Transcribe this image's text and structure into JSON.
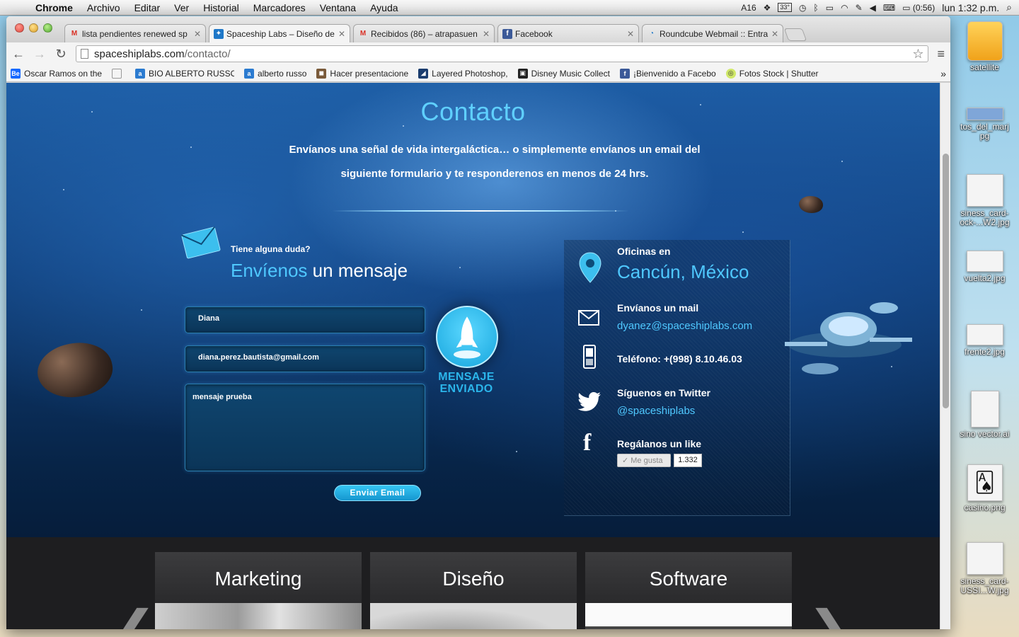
{
  "menubar": {
    "app": "Chrome",
    "items": [
      "Archivo",
      "Editar",
      "Ver",
      "Historial",
      "Marcadores",
      "Ventana",
      "Ayuda"
    ],
    "tray": {
      "adobe_count": "16",
      "temp": "33°",
      "battery": "(0:56)",
      "clock": "lun 1:32 p.m."
    }
  },
  "browser": {
    "tabs": [
      {
        "title": "lista pendientes renewed sp",
        "icon": "gmail-icon"
      },
      {
        "title": "Spaceship Labs – Diseño de",
        "icon": "spaceship-icon"
      },
      {
        "title": "Recibidos (86) – atrapasuen",
        "icon": "gmail-icon"
      },
      {
        "title": "Facebook",
        "icon": "facebook-icon"
      },
      {
        "title": "Roundcube Webmail :: Entra",
        "icon": "roundcube-icon"
      }
    ],
    "url_host": "spaceshiplabs.com",
    "url_path": "/contacto/",
    "bookmarks": [
      "Oscar Ramos on the",
      "",
      "BIO ALBERTO RUSSO",
      "alberto russo",
      "Hacer presentacione",
      "Layered Photoshop,",
      "Disney Music Collect",
      "¡Bienvenido a Facebo",
      "Fotos Stock | Shutter"
    ]
  },
  "page": {
    "title": "Contacto",
    "intro": "Envíanos una señal de vida intergaláctica… o simplemente envíanos un email del siguiente formulario y te responderenos en menos de 24 hrs.",
    "form": {
      "question": "Tiene alguna duda?",
      "heading_highlight": "Envíenos",
      "heading_rest": " un mensaje",
      "name_value": "Diana",
      "email_value": "diana.perez.bautista@gmail.com",
      "message_value": "mensaje prueba",
      "submit_label": "Enviar Email",
      "sent_line1": "MENSAJE",
      "sent_line2": "ENVIADO"
    },
    "info": {
      "office_label": "Oficinas en",
      "office_city": "Cancún, México",
      "mail_label": "Envíanos un mail",
      "mail_value": "dyanez@spaceshiplabs.com",
      "phone": "Teléfono: +(998) 8.10.46.03",
      "twitter_label": "Síguenos en Twitter",
      "twitter_handle": "@spaceshiplabs",
      "like_label": "Regálanos un like",
      "like_button": "✓ Me gusta",
      "like_count": "1.332"
    },
    "services": [
      "Marketing",
      "Diseño",
      "Software"
    ]
  },
  "desktop": [
    "satellite",
    "tos_del_marj\npg",
    "siness_card-\nock-...W2.jpg",
    "vuelta2.jpg",
    "frente2.jpg",
    "sino vector.ai",
    "casino.png",
    "siness_card-\nUSSI...W.jpg"
  ]
}
